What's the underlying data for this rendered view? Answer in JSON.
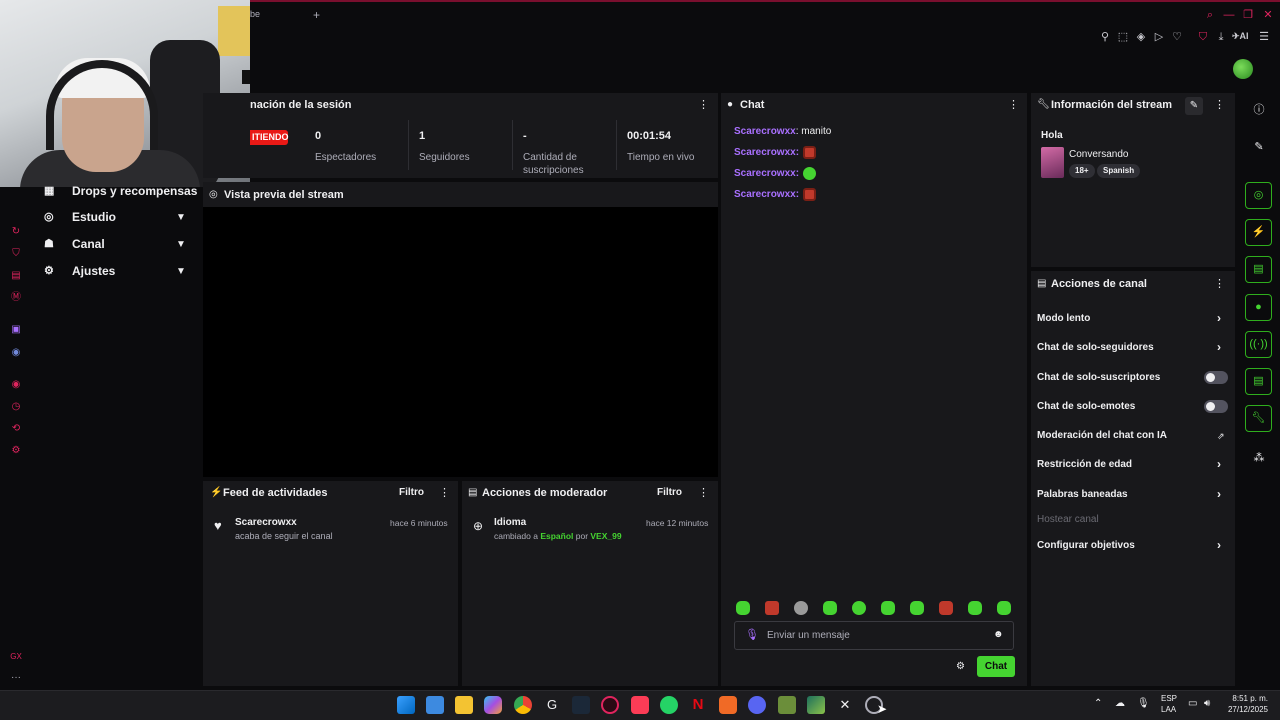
{
  "browser": {
    "tab_label": "be",
    "new_tab": "+",
    "ai_label": "AI"
  },
  "nav": {
    "items": [
      {
        "label": "Drops y recompensas",
        "icon": "gift-icon"
      },
      {
        "label": "Estudio",
        "icon": "studio-icon"
      },
      {
        "label": "Canal",
        "icon": "user-icon"
      },
      {
        "label": "Ajustes",
        "icon": "gear-icon"
      }
    ]
  },
  "session": {
    "title": "nación de la sesión",
    "live_badge": "ITIENDO",
    "stats": [
      {
        "value": "0",
        "label": "Espectadores"
      },
      {
        "value": "1",
        "label": "Seguidores"
      },
      {
        "value": "-",
        "label": "Cantidad de suscripciones"
      },
      {
        "value": "00:01:54",
        "label": "Tiempo en vivo"
      }
    ]
  },
  "preview": {
    "title": "Vista previa del stream"
  },
  "feed": {
    "title": "Feed de actividades",
    "filter": "Filtro",
    "item": {
      "user": "Scarecrowxx",
      "action": "acaba de seguir el canal",
      "time": "hace 6 minutos"
    }
  },
  "mod": {
    "title": "Acciones de moderador",
    "filter": "Filtro",
    "item": {
      "title": "Idioma",
      "prefix": "cambiado a ",
      "lang": "Español",
      "by": " por ",
      "user": "VEX_99",
      "time": "hace 12 minutos"
    }
  },
  "chat": {
    "title": "Chat",
    "messages": [
      {
        "user": "Scarecrowxx",
        "text": ": manito",
        "emote": ""
      },
      {
        "user": "Scarecrowxx",
        "text": ":",
        "emote": "red"
      },
      {
        "user": "Scarecrowxx",
        "text": ":",
        "emote": "green"
      },
      {
        "user": "Scarecrowxx",
        "text": ":",
        "emote": "red"
      }
    ],
    "input_placeholder": "Enviar un mensaje",
    "send_label": "Chat"
  },
  "stream_info": {
    "title": "Información del stream",
    "stream_title": "Hola",
    "category": "Conversando",
    "tags": [
      "18+",
      "Spanish"
    ]
  },
  "channel_actions": {
    "title": "Acciones de canal",
    "items": [
      {
        "label": "Modo lento",
        "control": "chevron"
      },
      {
        "label": "Chat de solo-seguidores",
        "control": "chevron"
      },
      {
        "label": "Chat de solo-suscriptores",
        "control": "toggle"
      },
      {
        "label": "Chat de solo-emotes",
        "control": "toggle"
      },
      {
        "label": "Moderación del chat con IA",
        "control": "external"
      },
      {
        "label": "Restricción de edad",
        "control": "chevron"
      },
      {
        "label": "Palabras baneadas",
        "control": "chevron"
      },
      {
        "label": "Hostear canal",
        "control": "none"
      },
      {
        "label": "Configurar objetivos",
        "control": "chevron"
      }
    ]
  },
  "taskbar": {
    "lang_top": "ESP",
    "lang_bottom": "LAA",
    "time": "8:51 p. m.",
    "date": "27/12/2025"
  },
  "colors": {
    "accent_green": "#45d431",
    "live_red": "#e91916",
    "username_purple": "#a970ff",
    "panel_bg": "#18181b"
  }
}
